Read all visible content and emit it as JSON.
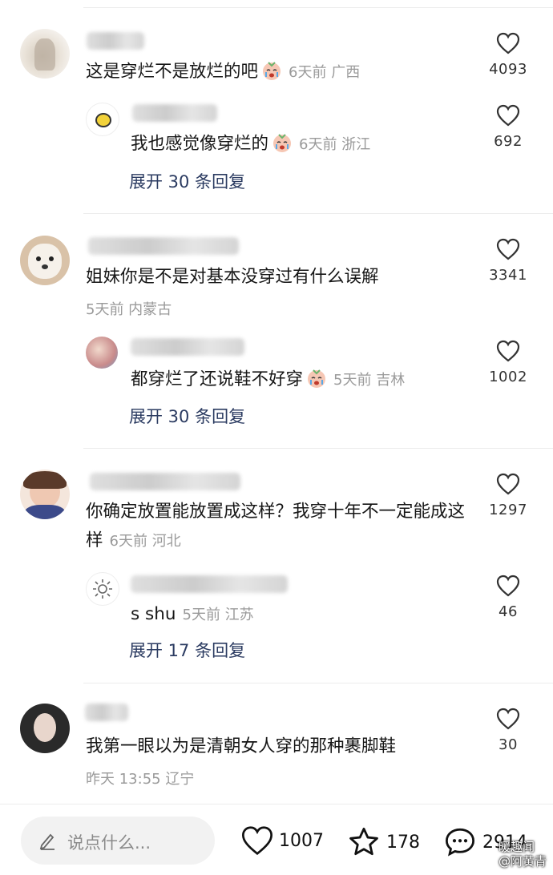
{
  "comments": [
    {
      "text": "这是穿烂不是放烂的吧",
      "meta": "6天前 广西",
      "likes": "4093",
      "reply": {
        "text": "我也感觉像穿烂的",
        "meta": "6天前 浙江",
        "likes": "692"
      },
      "expand": "展开 30 条回复"
    },
    {
      "text": "姐妹你是不是对基本没穿过有什么误解",
      "meta": "5天前 内蒙古",
      "likes": "3341",
      "reply": {
        "text": "都穿烂了还说鞋不好穿",
        "meta": "5天前 吉林",
        "likes": "1002"
      },
      "expand": "展开 30 条回复"
    },
    {
      "text": "你确定放置能放置成这样？我穿十年不一定能成这样",
      "meta": "6天前 河北",
      "likes": "1297",
      "reply": {
        "text": "s shu",
        "meta": "5天前 江苏",
        "likes": "46"
      },
      "expand": "展开 17 条回复"
    },
    {
      "text": "我第一眼以为是清朝女人穿的那种裹脚鞋",
      "meta": "昨天 13:55 辽宁",
      "likes": "30"
    }
  ],
  "bottom_bar": {
    "input_placeholder": "说点什么...",
    "likes": "1007",
    "favorites": "178",
    "comments": "2914"
  },
  "watermark": {
    "line1": "暖趣闻",
    "line2": "@阿黄青"
  },
  "colors": {
    "expand_link": "#2b3b61",
    "meta_gray": "#9a9a9a"
  }
}
